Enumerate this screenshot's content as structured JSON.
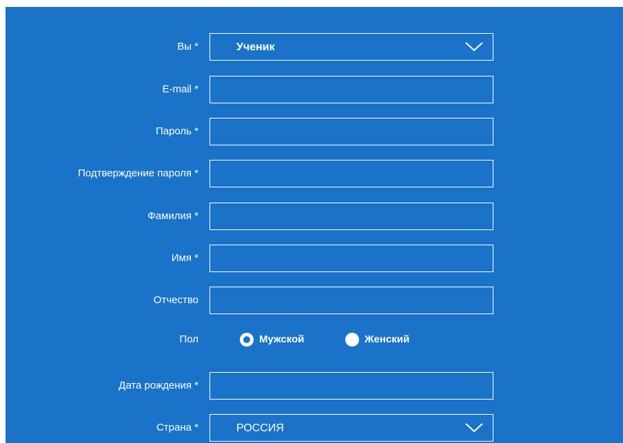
{
  "colors": {
    "panel_background": "#1a73c8",
    "text": "#ffffff",
    "field_border": "#ffffff"
  },
  "form": {
    "role": {
      "label": "Вы *",
      "value": "Ученик",
      "icon": "chevron-down-icon"
    },
    "email": {
      "label": "E-mail *",
      "value": ""
    },
    "password": {
      "label": "Пароль *",
      "value": ""
    },
    "password_confirm": {
      "label": "Подтверждение пароля *",
      "value": ""
    },
    "last_name": {
      "label": "Фамилия *",
      "value": ""
    },
    "first_name": {
      "label": "Имя *",
      "value": ""
    },
    "middle_name": {
      "label": "Отчество",
      "value": ""
    },
    "gender": {
      "label": "Пол",
      "options": [
        {
          "label": "Мужской",
          "selected": true
        },
        {
          "label": "Женский",
          "selected": false
        }
      ]
    },
    "birth_date": {
      "label": "Дата рождения *",
      "value": ""
    },
    "country": {
      "label": "Страна *",
      "value": "РОССИЯ",
      "icon": "chevron-down-icon"
    }
  }
}
